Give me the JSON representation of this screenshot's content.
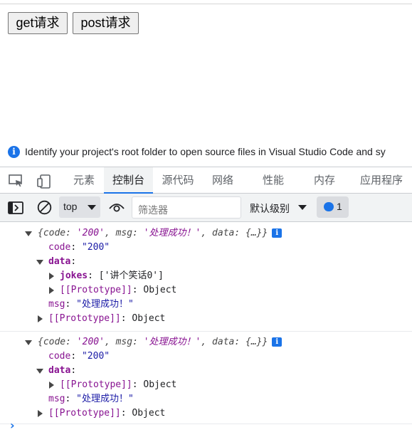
{
  "page": {
    "buttons": {
      "get_label": "get请求",
      "post_label": "post请求"
    }
  },
  "devtools": {
    "info_bar": {
      "text": "Identify your project's root folder to open source files in Visual Studio Code and sy",
      "icon": "info-icon"
    },
    "tabs": [
      {
        "label": "元素"
      },
      {
        "label": "控制台",
        "active": true
      },
      {
        "label": "源代码"
      },
      {
        "label": "网络"
      },
      {
        "label": "性能"
      },
      {
        "label": "内存"
      },
      {
        "label": "应用程序"
      }
    ],
    "toolbar": {
      "context": "top",
      "filter_placeholder": "筛选器",
      "level": "默认级别",
      "message_count": "1"
    },
    "colors": {
      "accent": "#1a73e8",
      "key": "#881391",
      "string": "#1a1aa6"
    }
  },
  "console": {
    "entries": [
      {
        "preview_open": "{code: ",
        "preview_code": "'200'",
        "preview_mid": ", msg: ",
        "preview_msg": "'处理成功！'",
        "preview_end": ", data: {…}}",
        "code_key": "code",
        "code_value": "\"200\"",
        "data_key": "data",
        "jokes_key": "jokes",
        "jokes_value": "['讲个笑话0']",
        "proto_label": "[[Prototype]]",
        "proto_value": "Object",
        "msg_key": "msg",
        "msg_value": "\"处理成功！\""
      },
      {
        "preview_open": "{code: ",
        "preview_code": "'200'",
        "preview_mid": ", msg: ",
        "preview_msg": "'处理成功！'",
        "preview_end": ", data: {…}}",
        "code_key": "code",
        "code_value": "\"200\"",
        "data_key": "data",
        "proto_label": "[[Prototype]]",
        "proto_value": "Object",
        "msg_key": "msg",
        "msg_value": "\"处理成功！\""
      }
    ],
    "prompt_glyph": "›"
  }
}
